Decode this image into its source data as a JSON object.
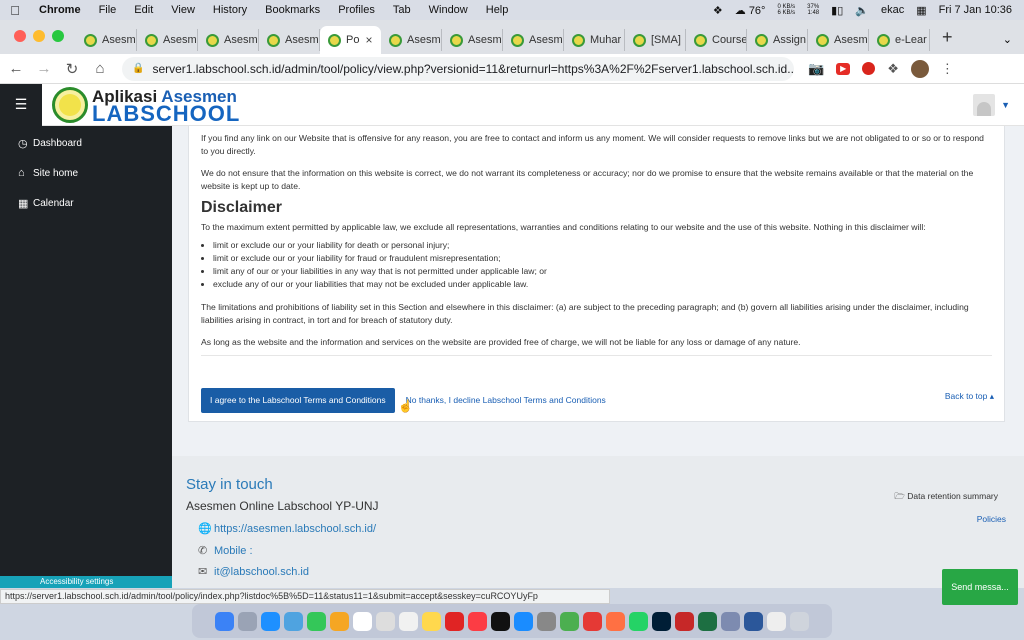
{
  "menubar": {
    "app": "Chrome",
    "menus": [
      "File",
      "Edit",
      "View",
      "History",
      "Bookmarks",
      "Profiles",
      "Tab",
      "Window",
      "Help"
    ],
    "weather": "76°",
    "net_up": "0 KB/s",
    "net_down": "6 KB/s",
    "battery": "37%",
    "battery_time": "1:48",
    "user": "ekac",
    "datetime": "Fri 7 Jan  10:36"
  },
  "tabs": [
    {
      "label": "Asesm"
    },
    {
      "label": "Asesm"
    },
    {
      "label": "Asesm"
    },
    {
      "label": "Asesm"
    },
    {
      "label": "Po",
      "active": true
    },
    {
      "label": "Asesm"
    },
    {
      "label": "Asesm"
    },
    {
      "label": "Asesm"
    },
    {
      "label": "Muhar"
    },
    {
      "label": "[SMA]"
    },
    {
      "label": "Course"
    },
    {
      "label": "Assign"
    },
    {
      "label": "Asesm"
    },
    {
      "label": "e-Lear"
    }
  ],
  "url": "server1.labschool.sch.id/admin/tool/policy/view.php?versionid=11&returnurl=https%3A%2F%2Fserver1.labschool.sch.id...",
  "logo": {
    "line1_a": "Aplikasi ",
    "line1_b": "Asesmen",
    "line2": "LABSCHOOL"
  },
  "sidebar": {
    "items": [
      {
        "label": "Dashboard",
        "icon": "dashboard-icon"
      },
      {
        "label": "Site home",
        "icon": "home-icon"
      },
      {
        "label": "Calendar",
        "icon": "calendar-icon"
      }
    ],
    "accessibility": "Accessibility settings"
  },
  "policy": {
    "p1": "If you find any link on our Website that is offensive for any reason, you are free to contact and inform us any moment. We will consider requests to remove links but we are not obligated to or so or to respond to you directly.",
    "p2": "We do not ensure that the information on this website is correct, we do not warrant its completeness or accuracy; nor do we promise to ensure that the website remains available or that the material on the website is kept up to date.",
    "heading": "Disclaimer",
    "p3": "To the maximum extent permitted by applicable law, we exclude all representations, warranties and conditions relating to our website and the use of this website. Nothing in this disclaimer will:",
    "bullets": [
      "limit or exclude our or your liability for death or personal injury;",
      "limit or exclude our or your liability for fraud or fraudulent misrepresentation;",
      "limit any of our or your liabilities in any way that is not permitted under applicable law; or",
      "exclude any of our or your liabilities that may not be excluded under applicable law."
    ],
    "p4": "The limitations and prohibitions of liability set in this Section and elsewhere in this disclaimer: (a) are subject to the preceding paragraph; and (b) govern all liabilities arising under the disclaimer, including liabilities arising in contract, in tort and for breach of statutory duty.",
    "p5": "As long as the website and the information and services on the website are provided free of charge, we will not be liable for any loss or damage of any nature.",
    "agree_label": "I agree to the Labschool Terms and Conditions",
    "decline_label": "No thanks, I decline Labschool Terms and Conditions",
    "back_to_top": "Back to top ▴"
  },
  "footer": {
    "heading": "Stay in touch",
    "org": "Asesmen Online Labschool YP-UNJ",
    "website": "https://asesmen.labschool.sch.id/",
    "mobile": "Mobile :",
    "email": "it@labschool.sch.id",
    "data_retention": "Data retention summary",
    "policies": "Policies"
  },
  "send_message": "Send messa...",
  "status_url": "https://server1.labschool.sch.id/admin/tool/policy/index.php?listdoc%5B%5D=11&status11=1&submit=accept&sesskey=cuRCOYUyFp"
}
